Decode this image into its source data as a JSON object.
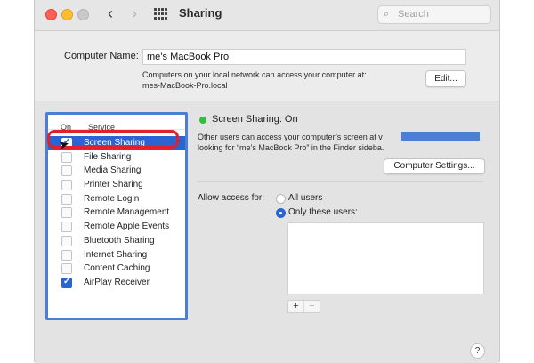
{
  "window": {
    "title": "Sharing",
    "search_placeholder": "Search"
  },
  "computer_name": {
    "label": "Computer Name:",
    "value": "me’s MacBook Pro",
    "note_line1": "Computers on your local network can access your computer at:",
    "note_line2": "mes-MacBook-Pro.local",
    "edit_label": "Edit..."
  },
  "services": {
    "col_on": "On",
    "col_service": "Service",
    "items": [
      {
        "label": "Screen Sharing",
        "checked": true,
        "selected": true
      },
      {
        "label": "File Sharing",
        "checked": false,
        "selected": false
      },
      {
        "label": "Media Sharing",
        "checked": false,
        "selected": false
      },
      {
        "label": "Printer Sharing",
        "checked": false,
        "selected": false
      },
      {
        "label": "Remote Login",
        "checked": false,
        "selected": false
      },
      {
        "label": "Remote Management",
        "checked": false,
        "selected": false
      },
      {
        "label": "Remote Apple Events",
        "checked": false,
        "selected": false
      },
      {
        "label": "Bluetooth Sharing",
        "checked": false,
        "selected": false
      },
      {
        "label": "Internet Sharing",
        "checked": false,
        "selected": false
      },
      {
        "label": "Content Caching",
        "checked": false,
        "selected": false
      },
      {
        "label": "AirPlay Receiver",
        "checked": true,
        "selected": false
      }
    ]
  },
  "detail": {
    "status": "Screen Sharing: On",
    "status_color": "#2fbf3a",
    "desc_line1": "Other users can access your computer’s screen at v",
    "desc_line2": "looking for “me’s MacBook Pro” in the Finder sideba.",
    "computer_settings_label": "Computer Settings...",
    "allow_access_label": "Allow access for:",
    "radio_all": "All users",
    "radio_only": "Only these users:",
    "add_symbol": "+",
    "remove_symbol": "−",
    "help_symbol": "?"
  },
  "colors": {
    "accent": "#2a64d3",
    "highlight_ring": "#e0202b",
    "panel_border": "#4a7fd4"
  }
}
